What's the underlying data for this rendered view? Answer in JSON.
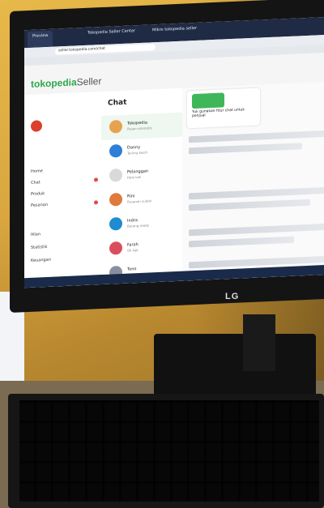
{
  "browser": {
    "tabs": [
      "Preview",
      "Tokopedia Seller Center",
      "Mikro tokopedia seller"
    ],
    "url": "seller.tokopedia.com/chat"
  },
  "app": {
    "logo_main": "tokopedia",
    "logo_sub": "Seller"
  },
  "sidebar": {
    "items": [
      "Home",
      "Chat",
      "Produk",
      "Pesanan",
      "Iklan",
      "Statistik",
      "Keuangan"
    ]
  },
  "chat": {
    "title": "Chat",
    "contacts": [
      {
        "name": "Tokopedia",
        "sub": "Pesan otomatis"
      },
      {
        "name": "Danny",
        "sub": "Terima kasih"
      },
      {
        "name": "Pelanggan",
        "sub": "Halo kak"
      },
      {
        "name": "Rini",
        "sub": "Pesanan sudah"
      },
      {
        "name": "Indra",
        "sub": "Barang ready"
      },
      {
        "name": "Farah",
        "sub": "Ok kak"
      },
      {
        "name": "Tono",
        "sub": "Siap"
      }
    ],
    "promo_text": "Yuk gunakan fitur chat untuk penjual"
  },
  "monitor": {
    "brand": "LG"
  },
  "colors": {
    "brand": "#2ea84a",
    "nav": "#1f2a44"
  }
}
